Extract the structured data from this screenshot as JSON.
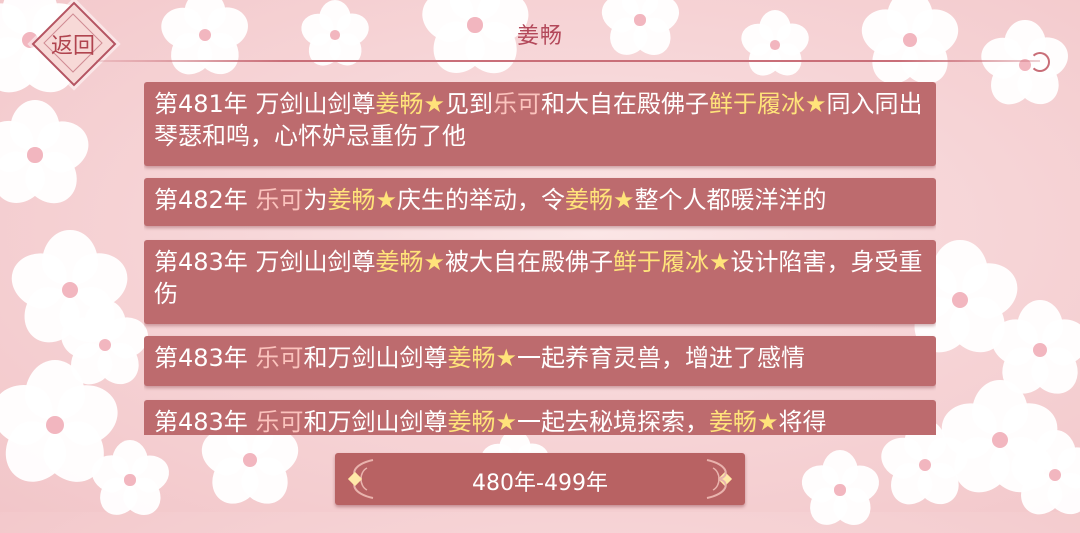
{
  "header": {
    "title": "姜畅",
    "back_label": "返回"
  },
  "events": [
    {
      "year": "第481年",
      "segments": [
        {
          "t": " 万剑山剑尊",
          "c": "w"
        },
        {
          "t": "姜畅★",
          "c": "y"
        },
        {
          "t": "见到",
          "c": "w"
        },
        {
          "t": "乐可",
          "c": "p"
        },
        {
          "t": "和大自在殿佛子",
          "c": "w"
        },
        {
          "t": "鲜于履冰★",
          "c": "y"
        },
        {
          "t": "同入同出琴瑟和鸣，心怀妒忌重伤了他",
          "c": "w"
        }
      ]
    },
    {
      "year": "第482年",
      "segments": [
        {
          "t": " ",
          "c": "w"
        },
        {
          "t": "乐可",
          "c": "p"
        },
        {
          "t": "为",
          "c": "w"
        },
        {
          "t": "姜畅★",
          "c": "y"
        },
        {
          "t": "庆生的举动，令",
          "c": "w"
        },
        {
          "t": "姜畅★",
          "c": "y"
        },
        {
          "t": "整个人都暖洋洋的",
          "c": "w"
        }
      ]
    },
    {
      "year": "第483年",
      "segments": [
        {
          "t": " 万剑山剑尊",
          "c": "w"
        },
        {
          "t": "姜畅★",
          "c": "y"
        },
        {
          "t": "被大自在殿佛子",
          "c": "w"
        },
        {
          "t": "鲜于履冰★",
          "c": "y"
        },
        {
          "t": "设计陷害，身受重伤",
          "c": "w"
        }
      ]
    },
    {
      "year": "第483年",
      "segments": [
        {
          "t": " ",
          "c": "w"
        },
        {
          "t": "乐可",
          "c": "p"
        },
        {
          "t": "和万剑山剑尊",
          "c": "w"
        },
        {
          "t": "姜畅★",
          "c": "y"
        },
        {
          "t": "一起养育灵兽，增进了感情",
          "c": "w"
        }
      ]
    },
    {
      "year": "第483年",
      "segments": [
        {
          "t": " ",
          "c": "w"
        },
        {
          "t": "乐可",
          "c": "p"
        },
        {
          "t": "和万剑山剑尊",
          "c": "w"
        },
        {
          "t": "姜畅★",
          "c": "y"
        },
        {
          "t": "一起去秘境探索，",
          "c": "w"
        },
        {
          "t": "姜畅★",
          "c": "y"
        },
        {
          "t": "将得",
          "c": "w"
        }
      ]
    }
  ],
  "era_selector": {
    "label": "480年-499年"
  },
  "colors": {
    "card": "#bd6b6e",
    "highlight_name": "#ffe37a",
    "partner_name": "#fbc3bd",
    "title": "#b3485a"
  },
  "icons": [
    "back-diamond-icon",
    "ornament-left-icon",
    "ornament-right-icon",
    "flower-icon"
  ]
}
